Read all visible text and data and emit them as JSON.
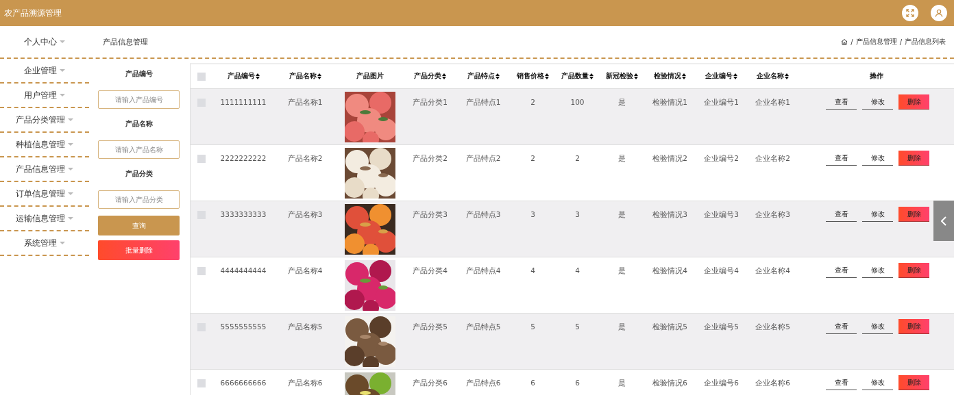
{
  "header": {
    "title": "农产品溯源管理"
  },
  "sidebar": {
    "items": [
      {
        "label": "个人中心"
      },
      {
        "label": "企业管理"
      },
      {
        "label": "用户管理"
      },
      {
        "label": "产品分类管理"
      },
      {
        "label": "种植信息管理"
      },
      {
        "label": "产品信息管理"
      },
      {
        "label": "订单信息管理"
      },
      {
        "label": "运输信息管理"
      },
      {
        "label": "系统管理"
      }
    ]
  },
  "page_title": "产品信息管理",
  "breadcrumb": {
    "separator": "/",
    "items": [
      "产品信息管理",
      "产品信息列表"
    ]
  },
  "filters": [
    {
      "label": "产品编号",
      "placeholder": "请输入产品编号"
    },
    {
      "label": "产品名称",
      "placeholder": "请输入产品名称"
    },
    {
      "label": "产品分类",
      "placeholder": "请输入产品分类"
    }
  ],
  "filter_buttons": [
    {
      "label": "查询",
      "kind": "search"
    },
    {
      "label": "批量删除",
      "kind": "danger"
    }
  ],
  "table": {
    "select_all_checked": false,
    "columns": [
      {
        "label": "产品编号",
        "sortable": true
      },
      {
        "label": "产品名称",
        "sortable": true
      },
      {
        "label": "产品图片",
        "sortable": false
      },
      {
        "label": "产品分类",
        "sortable": true
      },
      {
        "label": "产品特点",
        "sortable": true
      },
      {
        "label": "销售价格",
        "sortable": true
      },
      {
        "label": "产品数量",
        "sortable": true
      },
      {
        "label": "新冠检验",
        "sortable": true
      },
      {
        "label": "检验情况",
        "sortable": true
      },
      {
        "label": "企业编号",
        "sortable": true
      },
      {
        "label": "企业名称",
        "sortable": true
      },
      {
        "label": "操作",
        "sortable": false
      }
    ],
    "rows": [
      {
        "checked": false,
        "cells": [
          "1111111111",
          "产品名称1",
          {
            "kind": "picture"
          },
          "产品分类1",
          "产品特点1",
          "2",
          "100",
          "是",
          "检验情况1",
          "企业编号1",
          "企业名称1"
        ],
        "actions": [
          "查看",
          "修改",
          "删除"
        ]
      },
      {
        "checked": false,
        "cells": [
          "2222222222",
          "产品名称2",
          {
            "kind": "picture"
          },
          "产品分类2",
          "产品特点2",
          "2",
          "2",
          "是",
          "检验情况2",
          "企业编号2",
          "企业名称2"
        ],
        "actions": [
          "查看",
          "修改",
          "删除"
        ]
      },
      {
        "checked": false,
        "cells": [
          "3333333333",
          "产品名称3",
          {
            "kind": "picture"
          },
          "产品分类3",
          "产品特点3",
          "3",
          "3",
          "是",
          "检验情况3",
          "企业编号3",
          "企业名称3"
        ],
        "actions": [
          "查看",
          "修改",
          "删除"
        ]
      },
      {
        "checked": false,
        "cells": [
          "4444444444",
          "产品名称4",
          {
            "kind": "picture"
          },
          "产品分类4",
          "产品特点4",
          "4",
          "4",
          "是",
          "检验情况4",
          "企业编号4",
          "企业名称4"
        ],
        "actions": [
          "查看",
          "修改",
          "删除"
        ]
      },
      {
        "checked": false,
        "cells": [
          "5555555555",
          "产品名称5",
          {
            "kind": "picture"
          },
          "产品分类5",
          "产品特点5",
          "5",
          "5",
          "是",
          "检验情况5",
          "企业编号5",
          "企业名称5"
        ],
        "actions": [
          "查看",
          "修改",
          "删除"
        ]
      },
      {
        "checked": false,
        "cells": [
          "6666666666",
          "产品名称6",
          {
            "kind": "picture"
          },
          "产品分类6",
          "产品特点6",
          "6",
          "6",
          "是",
          "检验情况6",
          "企业编号6",
          "企业名称6"
        ],
        "actions": [
          "查看",
          "修改",
          "删除"
        ]
      }
    ]
  }
}
